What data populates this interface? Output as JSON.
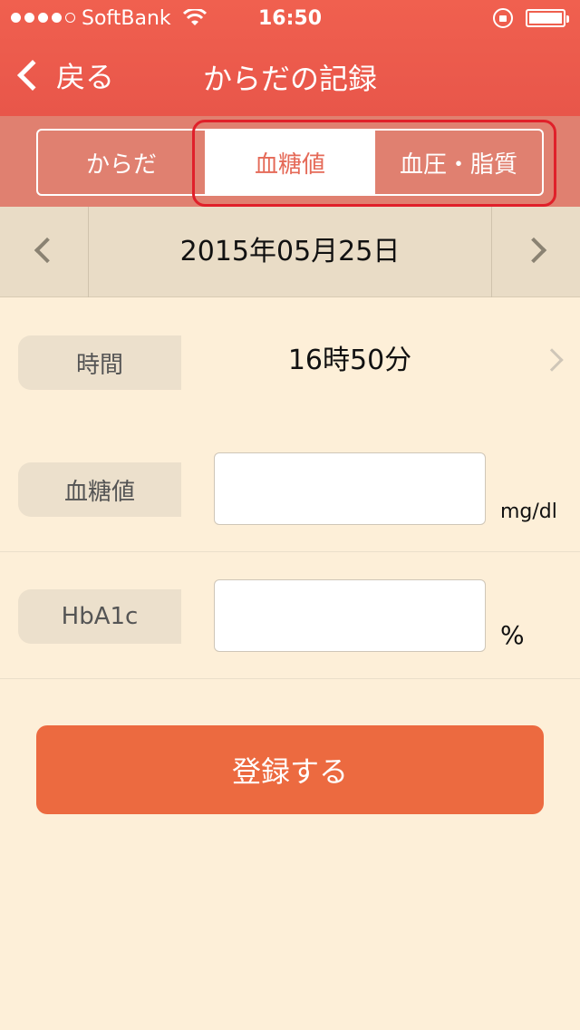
{
  "status_bar": {
    "carrier": "SoftBank",
    "time": "16:50"
  },
  "nav": {
    "back_label": "戻る",
    "title": "からだの記録"
  },
  "tabs": [
    {
      "label": "からだ",
      "active": false
    },
    {
      "label": "血糖値",
      "active": true
    },
    {
      "label": "血圧・脂質",
      "active": false
    }
  ],
  "date": {
    "value": "2015年05月25日"
  },
  "form": {
    "time_label": "時間",
    "time_value": "16時50分",
    "glucose_label": "血糖値",
    "glucose_value": "",
    "glucose_unit": "mg/dl",
    "hba1c_label": "HbA1c",
    "hba1c_value": "",
    "hba1c_unit": "%"
  },
  "submit_label": "登録する",
  "colors": {
    "header": "#ed5b4d",
    "segment_bg": "#e08070",
    "active_tab_text": "#e56a58",
    "highlight": "#e0202a",
    "date_bar": "#e9dcc6",
    "background": "#fdefd8",
    "submit": "#ec6a40"
  }
}
